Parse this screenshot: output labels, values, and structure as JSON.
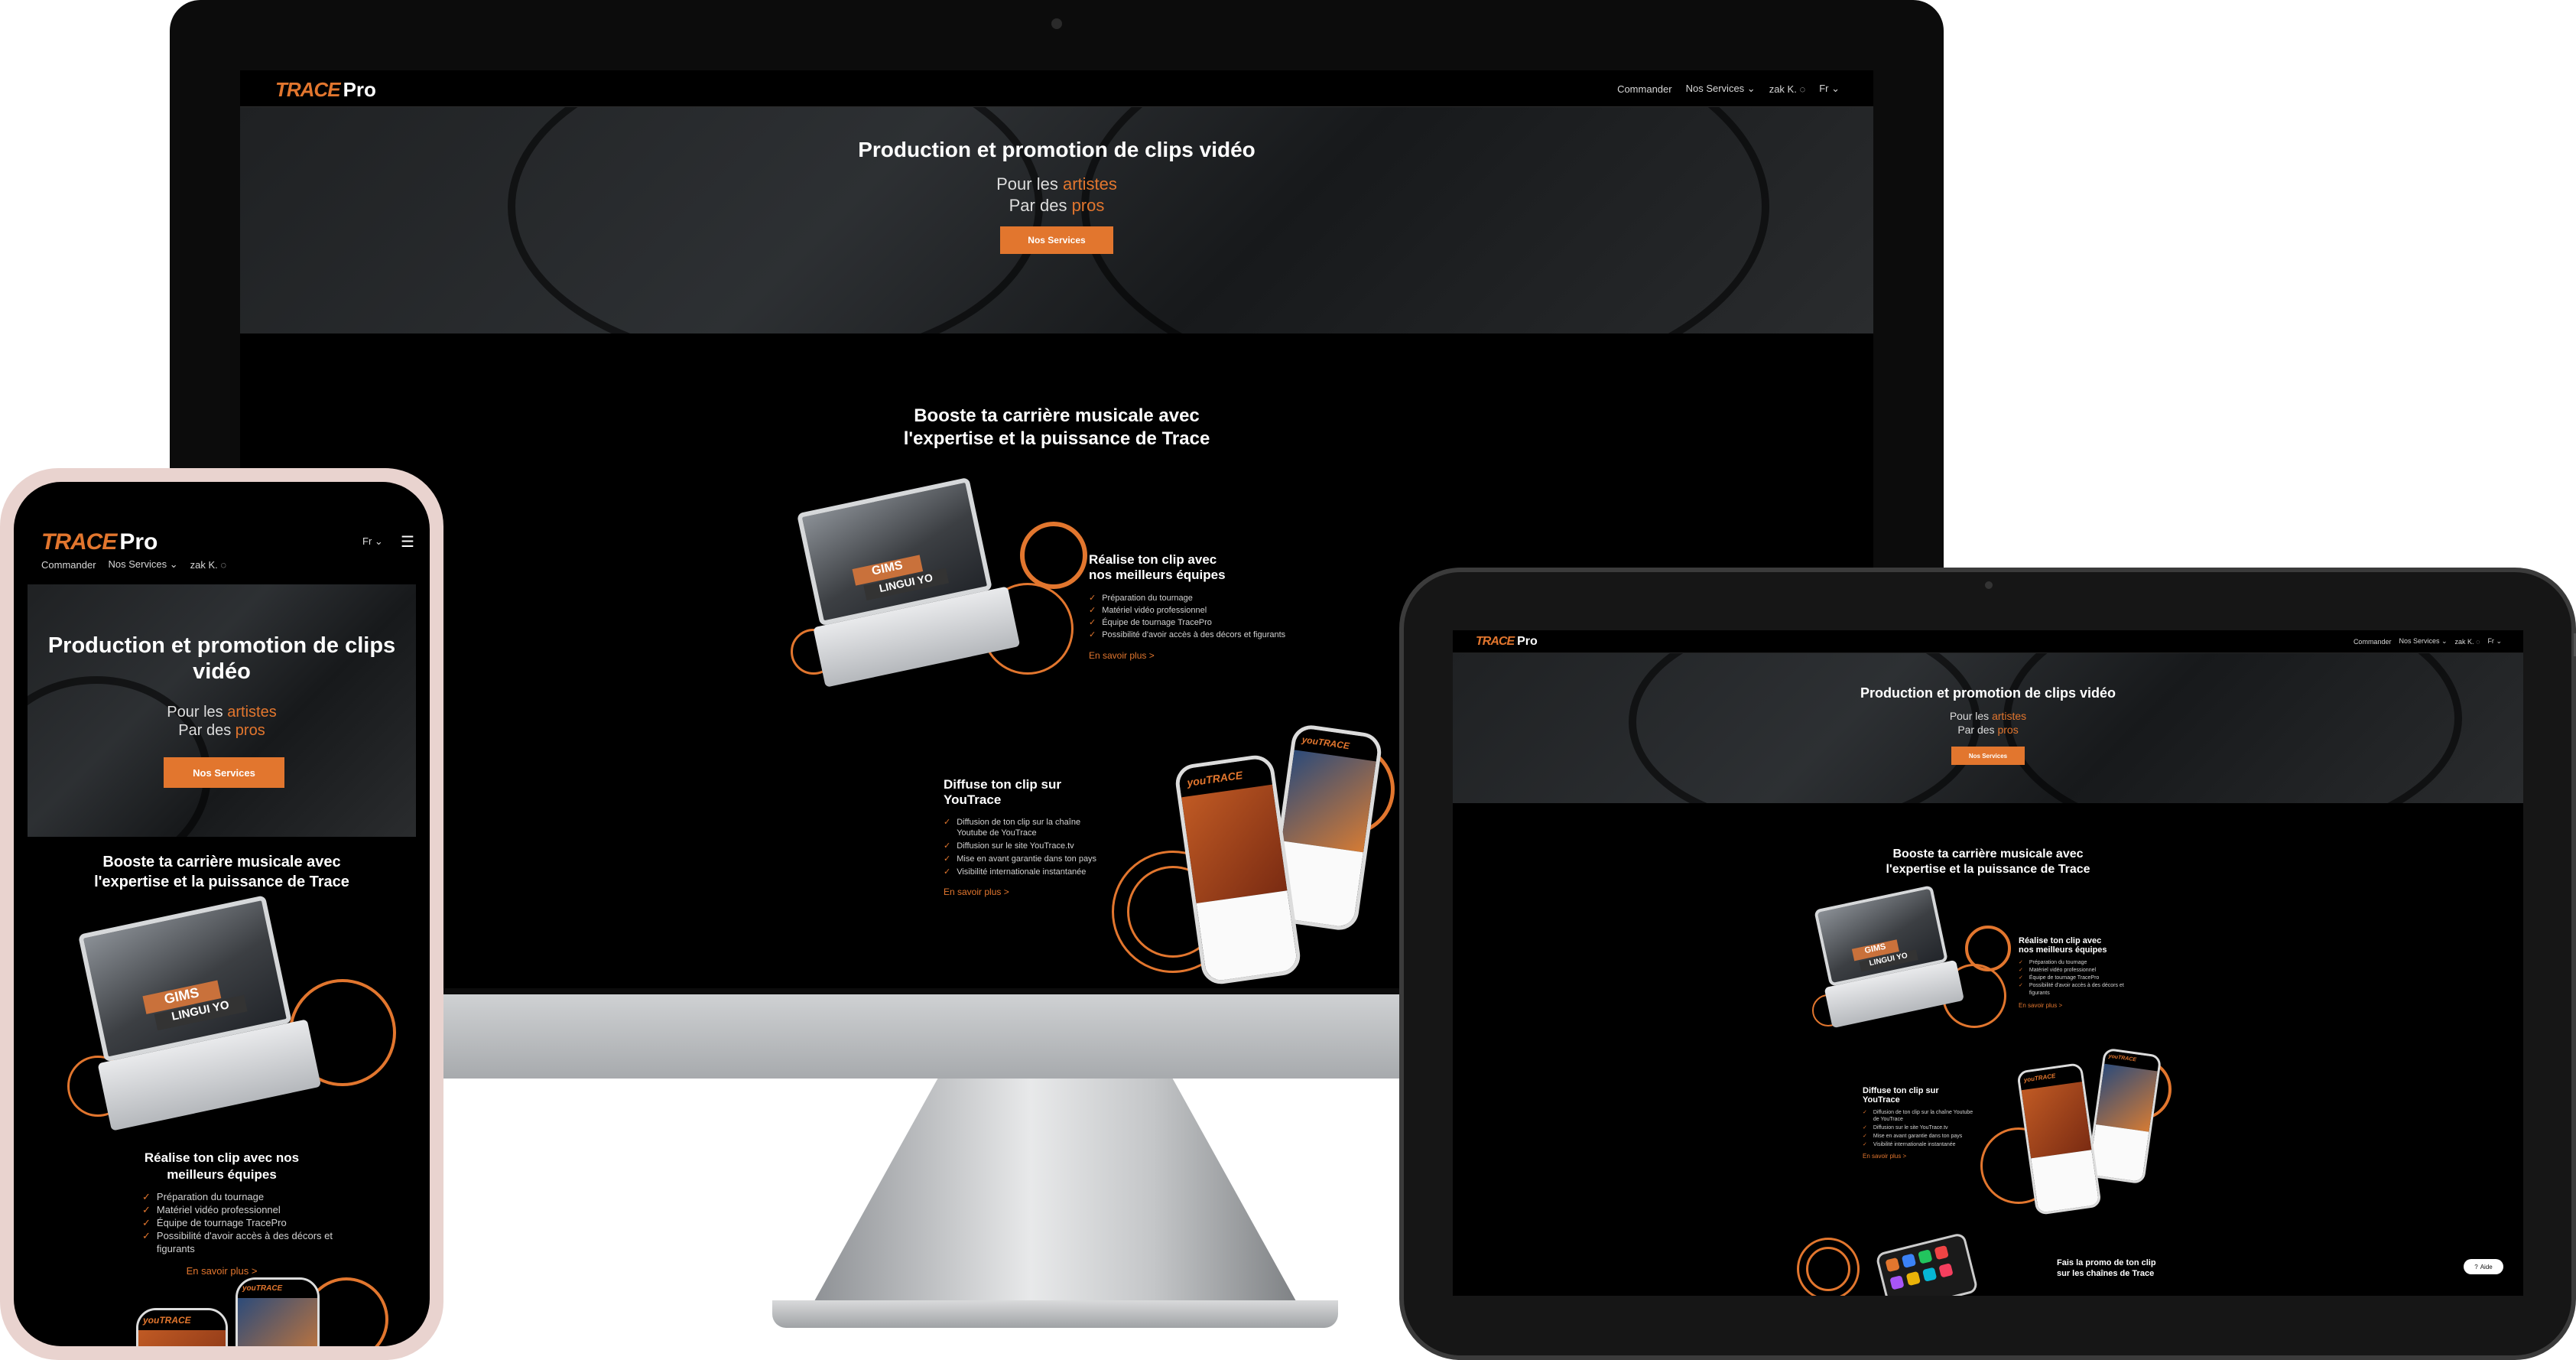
{
  "brand": {
    "logo_trace": "TRACE",
    "logo_pro": "Pro"
  },
  "nav": {
    "commander": "Commander",
    "services": "Nos Services",
    "user": "zak K.",
    "lang": "Fr"
  },
  "hero": {
    "title": "Production et promotion de clips vidéo",
    "line1_prefix": "Pour les ",
    "line1_accent": "artistes",
    "line2_prefix": "Par des ",
    "line2_accent": "pros",
    "cta": "Nos Services"
  },
  "section": {
    "title_line1": "Booste ta carrière musicale avec",
    "title_line2": "l'expertise et la puissance de Trace"
  },
  "feature1": {
    "title_line1": "Réalise ton clip avec",
    "title_line2": "nos meilleurs équipes",
    "items": [
      "Préparation du tournage",
      "Matériel vidéo professionnel",
      "Équipe de tournage TracePro",
      "Possibilité d'avoir accès à des décors et figurants"
    ],
    "link": "En savoir plus >"
  },
  "feature2": {
    "title_line1": "Diffuse ton clip sur",
    "title_line2": "YouTrace",
    "items": [
      "Diffusion de ton clip sur la chaîne Youtube de YouTrace",
      "Diffusion sur le site YouTrace.tv",
      "Mise en avant garantie dans ton pays",
      "Visibilité internationale instantanée"
    ],
    "link": "En savoir plus >"
  },
  "feature3": {
    "title": "Fais la promo de ton clip sur les chaînes de Trace"
  },
  "mobile": {
    "hero_title_line1": "Production et promotion de clips",
    "hero_title_line2": "vidéo",
    "feature1_title_line1": "Réalise ton clip avec nos",
    "feature1_title_line2": "meilleurs équipes"
  },
  "laptop_art": {
    "gims": "GIMS",
    "song": "LINGUI YO"
  },
  "tablet_badge": {
    "label": "Aide"
  },
  "colors": {
    "accent": "#e2762e",
    "background": "#000000",
    "device_bezel": "#0d0d0d"
  }
}
